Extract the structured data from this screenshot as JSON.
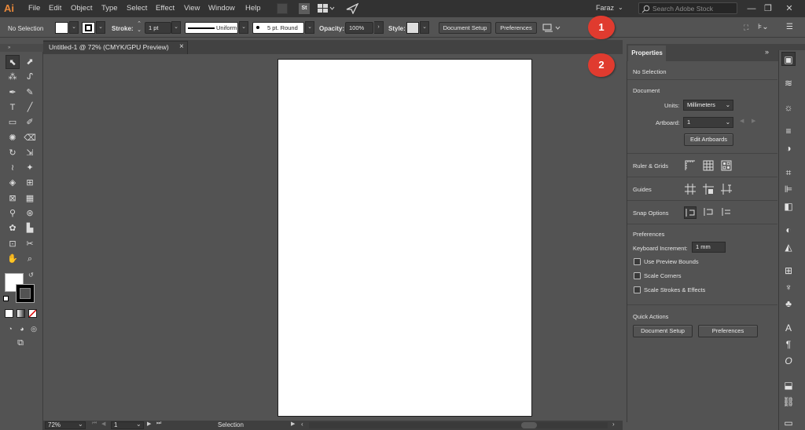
{
  "app": {
    "logo": "Ai",
    "name": "Adobe Illustrator"
  },
  "menu": [
    "File",
    "Edit",
    "Object",
    "Type",
    "Select",
    "Effect",
    "View",
    "Window",
    "Help"
  ],
  "user": "Faraz",
  "search": {
    "placeholder": "Search Adobe Stock"
  },
  "control": {
    "selection": "No Selection",
    "stroke_label": "Stroke:",
    "stroke_value": "1 pt",
    "profile": "Uniform",
    "brush": "5 pt. Round",
    "opacity_label": "Opacity:",
    "opacity_value": "100%",
    "style_label": "Style:",
    "doc_setup": "Document Setup",
    "preferences": "Preferences"
  },
  "callouts": [
    "1",
    "2"
  ],
  "document_tab": {
    "title": "Untitled-1 @ 72% (CMYK/GPU Preview)",
    "close": "×"
  },
  "tools": [
    "selection-tool",
    "direct-selection-tool",
    "magic-wand-tool",
    "lasso-tool",
    "pen-tool",
    "curvature-tool",
    "type-tool",
    "line-tool",
    "rectangle-tool",
    "paintbrush-tool",
    "shaper-tool",
    "eraser-tool",
    "rotate-tool",
    "scale-tool",
    "width-tool",
    "puppet-warp-tool",
    "shape-builder-tool",
    "perspective-grid-tool",
    "mesh-tool",
    "gradient-tool",
    "eyedropper-tool",
    "blend-tool",
    "symbol-sprayer-tool",
    "column-graph-tool",
    "artboard-tool",
    "slice-tool",
    "hand-tool",
    "zoom-tool"
  ],
  "status": {
    "zoom": "72%",
    "artboard": "1",
    "tool": "Selection"
  },
  "properties": {
    "tab": "Properties",
    "collapse": "»",
    "no_selection": "No Selection",
    "document_heading": "Document",
    "units_label": "Units:",
    "units_value": "Millimeters",
    "artboard_label": "Artboard:",
    "artboard_value": "1",
    "edit_artboards": "Edit Artboards",
    "ruler_grids": "Ruler & Grids",
    "guides": "Guides",
    "snap_options": "Snap Options",
    "preferences_heading": "Preferences",
    "keyboard_increment_label": "Keyboard Increment:",
    "keyboard_increment_value": "1 mm",
    "use_preview_bounds": "Use Preview Bounds",
    "scale_corners": "Scale Corners",
    "scale_strokes": "Scale Strokes & Effects",
    "quick_actions": "Quick Actions",
    "qa_document_setup": "Document Setup",
    "qa_preferences": "Preferences"
  },
  "colors": {
    "ui_bg": "#535353",
    "menu_bg": "#323232",
    "accent": "#e8893b",
    "callout": "#e03b2f"
  }
}
